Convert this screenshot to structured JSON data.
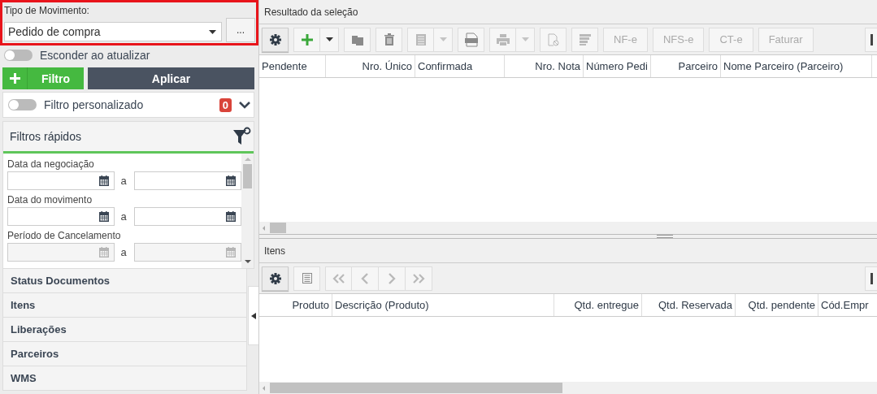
{
  "movement_type": {
    "label": "Tipo de Movimento:",
    "value": "Pedido de compra",
    "more_button": "...",
    "highlighted": true
  },
  "hide_on_update": {
    "label": "Esconder ao atualizar",
    "on": false
  },
  "filter_button": {
    "label": "Filtro"
  },
  "apply_button": {
    "label": "Aplicar"
  },
  "custom_filter": {
    "label": "Filtro personalizado",
    "on": false,
    "count": "0",
    "expanded": false
  },
  "quick_filters": {
    "title": "Filtros rápidos",
    "fields": [
      {
        "label": "Data da negociação",
        "separator": "a",
        "disabled": false
      },
      {
        "label": "Data do movimento",
        "separator": "a",
        "disabled": false
      },
      {
        "label": "Período de Cancelamento",
        "separator": "a",
        "disabled": true
      }
    ]
  },
  "sections": [
    {
      "label": "Status Documentos"
    },
    {
      "label": "Itens"
    },
    {
      "label": "Liberações"
    },
    {
      "label": "Parceiros"
    },
    {
      "label": "WMS"
    }
  ],
  "results": {
    "title": "Resultado da seleção",
    "toolbar": [
      {
        "kind": "settings",
        "disabled": false
      },
      {
        "kind": "add",
        "disabled": false,
        "split": true
      },
      {
        "kind": "copy",
        "disabled": false
      },
      {
        "kind": "delete",
        "disabled": false
      },
      {
        "kind": "list",
        "disabled": true,
        "split": true
      },
      {
        "kind": "pdf",
        "disabled": false
      },
      {
        "kind": "print",
        "disabled": true,
        "split": true
      },
      {
        "kind": "cancel-doc",
        "disabled": true
      },
      {
        "kind": "stack",
        "disabled": true
      },
      {
        "kind": "text",
        "label": "NF-e",
        "disabled": true
      },
      {
        "kind": "text",
        "label": "NFS-e",
        "disabled": true
      },
      {
        "kind": "text",
        "label": "CT-e",
        "disabled": true
      },
      {
        "kind": "text",
        "label": "Faturar",
        "disabled": true
      }
    ],
    "columns": [
      {
        "label": "Pendente"
      },
      {
        "label": "Nro. Único"
      },
      {
        "label": "Confirmada"
      },
      {
        "label": "Nro. Nota"
      },
      {
        "label": "Número Pedi"
      },
      {
        "label": "Parceiro"
      },
      {
        "label": "Nome Parceiro (Parceiro)"
      }
    ]
  },
  "items": {
    "title": "Itens",
    "toolbar": [
      {
        "kind": "settings",
        "disabled": false
      },
      {
        "kind": "detail",
        "disabled": false
      },
      {
        "kind": "first",
        "disabled": true
      },
      {
        "kind": "prev",
        "disabled": true
      },
      {
        "kind": "next",
        "disabled": true
      },
      {
        "kind": "last",
        "disabled": true
      }
    ],
    "columns": [
      {
        "label": "Produto"
      },
      {
        "label": "Descrição (Produto)"
      },
      {
        "label": "Qtd. entregue"
      },
      {
        "label": "Qtd. Reservada"
      },
      {
        "label": "Qtd. pendente"
      },
      {
        "label": "Cód.Empr"
      }
    ]
  }
}
